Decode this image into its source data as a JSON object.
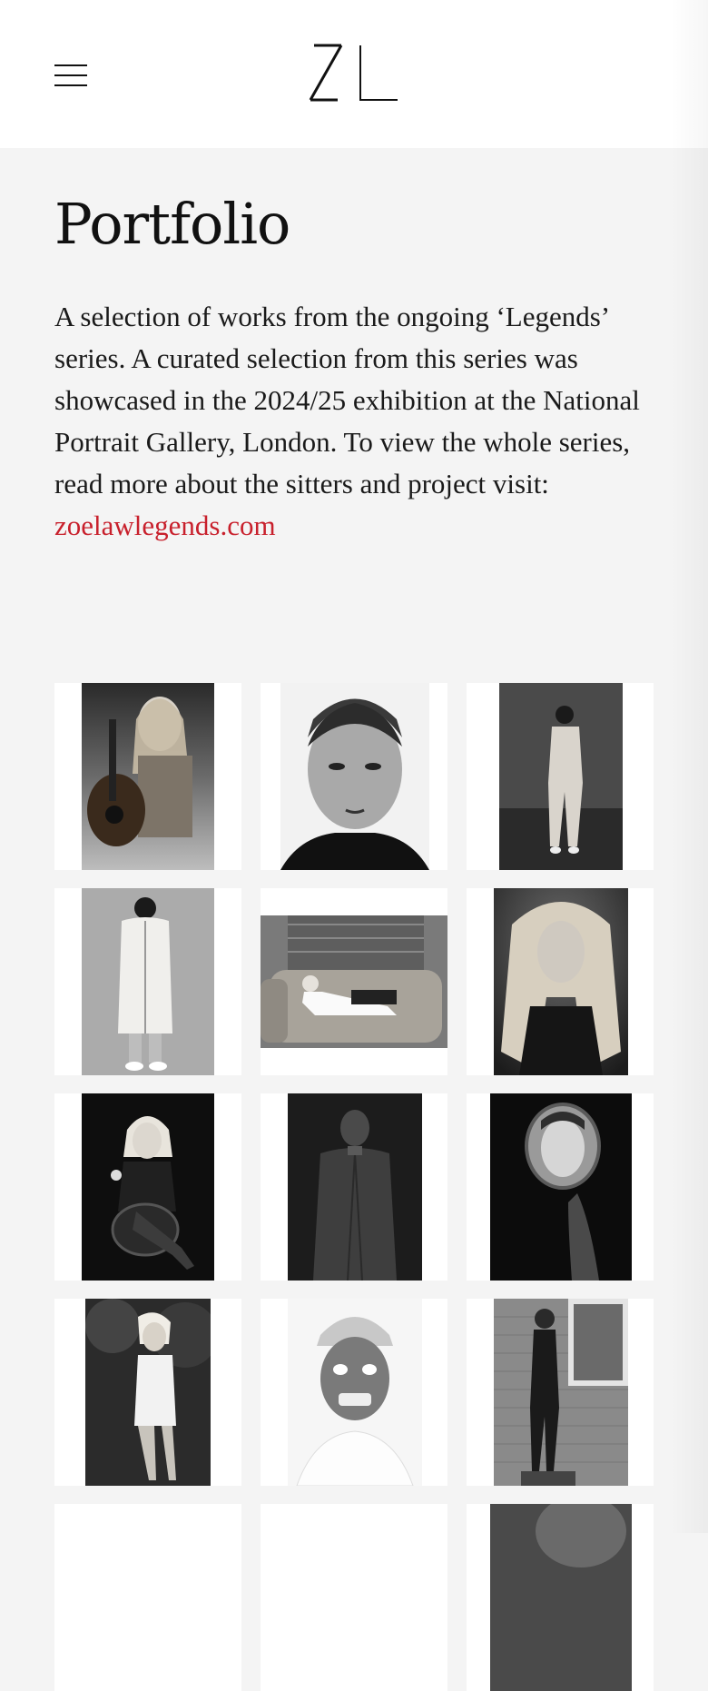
{
  "header": {
    "menu_icon": "hamburger-menu-icon",
    "logo_text": "ZL"
  },
  "page": {
    "title": "Portfolio",
    "intro": "A selection of works from the ongoing ‘Legends’ series. A curated selection from this series was showcased in the 2024/25 exhibition at the National Portrait Gallery, London. To view the whole series, read more about the sitters and project visit: ",
    "link_text": "zoelawlegends.com"
  },
  "colors": {
    "background": "#f4f4f4",
    "header": "#ffffff",
    "link": "#c8202c",
    "text": "#111111"
  },
  "gallery": [
    {
      "subject": "woman-with-guitar"
    },
    {
      "subject": "man-close-up-portrait"
    },
    {
      "subject": "man-standing-light-suit"
    },
    {
      "subject": "man-in-puffer-coat"
    },
    {
      "subject": "woman-on-leather-sofa"
    },
    {
      "subject": "woman-long-blonde-hair"
    },
    {
      "subject": "woman-seated-on-chair"
    },
    {
      "subject": "man-in-long-coat"
    },
    {
      "subject": "face-in-hand-mirror"
    },
    {
      "subject": "woman-in-garden"
    },
    {
      "subject": "man-in-cap-laughing"
    },
    {
      "subject": "woman-in-catsuit-by-window"
    },
    {
      "subject": "portrait-partial"
    },
    {
      "subject": "portrait-partial"
    },
    {
      "subject": "portrait-partial"
    }
  ]
}
